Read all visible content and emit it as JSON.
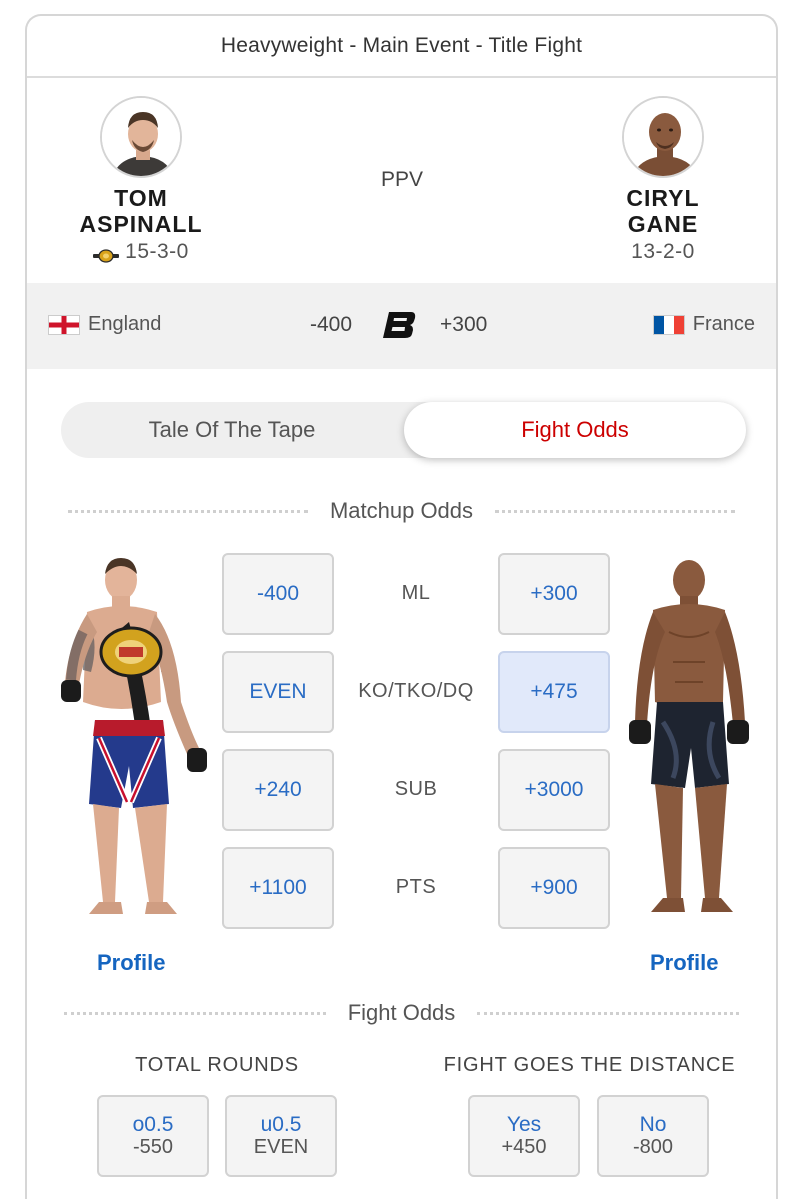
{
  "header": {
    "title": "Heavyweight - Main Event - Title Fight"
  },
  "event_tag": "PPV",
  "fighter_left": {
    "first_name": "TOM",
    "last_name": "ASPINALL",
    "record": "15-3-0",
    "country": "England",
    "moneyline": "-400",
    "profile_label": "Profile"
  },
  "fighter_right": {
    "first_name": "CIRYL",
    "last_name": "GANE",
    "record": "13-2-0",
    "country": "France",
    "moneyline": "+300",
    "profile_label": "Profile"
  },
  "tabs": [
    {
      "label": "Tale Of The Tape",
      "selected": false
    },
    {
      "label": "Fight Odds",
      "selected": true
    }
  ],
  "matchup": {
    "title": "Matchup Odds",
    "rows": [
      {
        "label": "ML",
        "left": "-400",
        "right": "+300",
        "right_selected": false
      },
      {
        "label": "KO/TKO/DQ",
        "left": "EVEN",
        "right": "+475",
        "right_selected": true
      },
      {
        "label": "SUB",
        "left": "+240",
        "right": "+3000",
        "right_selected": false
      },
      {
        "label": "PTS",
        "left": "+1100",
        "right": "+900",
        "right_selected": false
      }
    ]
  },
  "fight_odds": {
    "title": "Fight Odds",
    "total_rounds": {
      "heading": "TOTAL ROUNDS",
      "options": [
        {
          "line": "o0.5",
          "odds": "-550"
        },
        {
          "line": "u0.5",
          "odds": "EVEN"
        }
      ]
    },
    "distance": {
      "heading": "FIGHT GOES THE DISTANCE",
      "options": [
        {
          "line": "Yes",
          "odds": "+450"
        },
        {
          "line": "No",
          "odds": "-800"
        }
      ]
    }
  },
  "colors": {
    "accent_red": "#cc0000",
    "link_blue": "#1565c0",
    "odds_blue": "#2a6cc4",
    "selected_bg": "#e1e9fa"
  },
  "icons": [
    "championship-belt-icon",
    "england-flag-icon",
    "france-flag-icon",
    "sportsbook-logo-icon"
  ]
}
